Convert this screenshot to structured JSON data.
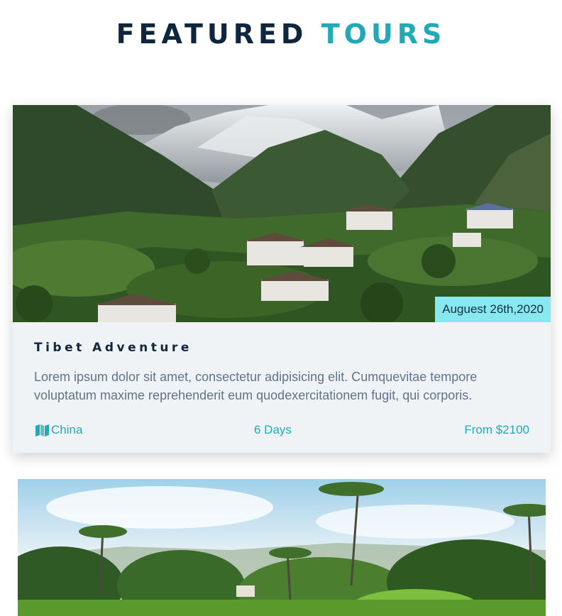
{
  "header": {
    "title_part1": "FEATURED",
    "title_part2": "TOURS"
  },
  "tours": [
    {
      "date": "Auguest 26th,2020",
      "title": "Tibet Adventure",
      "description": "Lorem ipsum dolor sit amet, consectetur adipisicing elit. Cumquevitae tempore voluptatum maxime reprehenderit eum quodexercitationem fugit, qui corporis.",
      "location": "China",
      "location_icon": "map-icon",
      "duration": "6 Days",
      "price": "From $2100"
    }
  ],
  "colors": {
    "dark": "#10263e",
    "accent": "#21a9b8",
    "badge": "#87e8ef",
    "card_bg": "#f0f3f6",
    "body_text": "#5f7489"
  }
}
